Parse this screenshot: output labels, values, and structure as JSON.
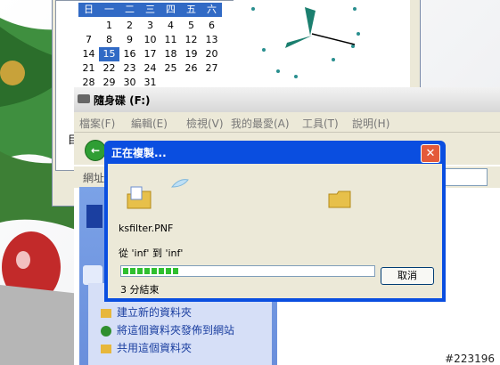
{
  "calendar": {
    "weekdays": [
      "日",
      "一",
      "二",
      "三",
      "四",
      "五",
      "六"
    ],
    "days": [
      "",
      "1",
      "2",
      "3",
      "4",
      "5",
      "6",
      "7",
      "8",
      "9",
      "10",
      "11",
      "12",
      "13",
      "14",
      "15",
      "16",
      "17",
      "18",
      "19",
      "20",
      "21",
      "22",
      "23",
      "24",
      "25",
      "26",
      "27",
      "28",
      "29",
      "30",
      "31",
      "",
      "",
      ""
    ],
    "selected_day": "15"
  },
  "left_label": "目",
  "explorer": {
    "title": "隨身碟 (F:)",
    "menu": [
      "檔案(F)",
      "編輯(E)",
      "檢視(V)",
      "我的最愛(A)",
      "工具(T)",
      "說明(H)"
    ],
    "address_label": "網址",
    "tasks": [
      "建立新的資料夾",
      "將這個資料夾發佈到網站",
      "共用這個資料夾"
    ]
  },
  "copy_dialog": {
    "title": "正在複製...",
    "close_label": "✕",
    "filename": "ksfilter.PNF",
    "from_to": "從 'inf' 到 'inf'",
    "progress": 0.22,
    "cancel_label": "取消",
    "time_left": "3 分結束"
  },
  "watermark": "#223196",
  "colors": {
    "title_blue": "#0a4ee0",
    "progress_green": "#2fbf2f"
  }
}
